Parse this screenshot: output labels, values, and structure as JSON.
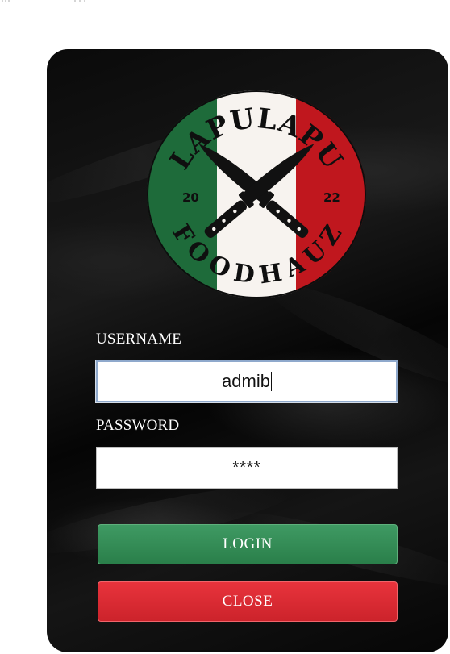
{
  "logo": {
    "top_text": "LAPULAPU",
    "bottom_text": "FOODHAUZ",
    "year_left": "20",
    "year_right": "22",
    "colors": {
      "green": "#1e6b3a",
      "white": "#f7f3ef",
      "red": "#c0171e",
      "text": "#0f0f0f"
    }
  },
  "form": {
    "username_label": "USERNAME",
    "username_value": "admib",
    "password_label": "PASSWORD",
    "password_value": "****"
  },
  "buttons": {
    "login_label": "LOGIN",
    "close_label": "CLOSE"
  },
  "colors": {
    "background": "#0b0b0b",
    "login": "#2f8a52",
    "close": "#dc2a33"
  }
}
